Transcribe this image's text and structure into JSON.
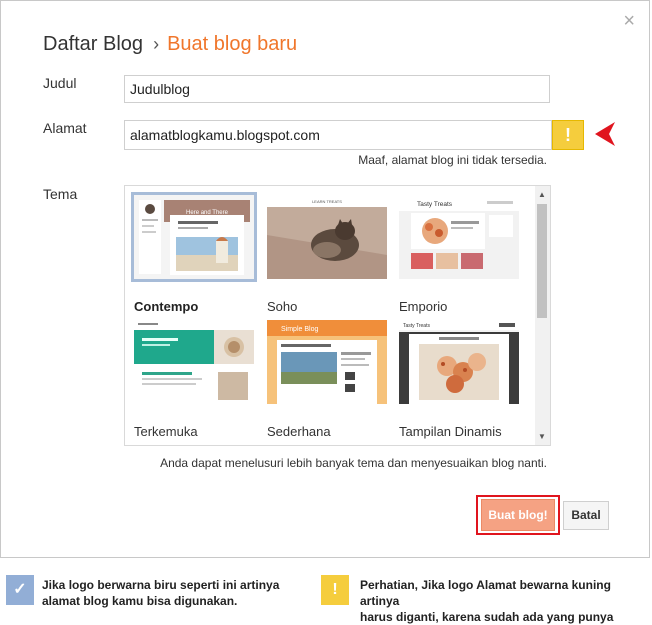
{
  "dialog": {
    "close_glyph": "×",
    "breadcrumb_root": "Daftar Blog",
    "breadcrumb_sep": "›",
    "breadcrumb_current": "Buat blog baru"
  },
  "form": {
    "title_label": "Judul",
    "title_value": "Judulblog",
    "address_label": "Alamat",
    "address_value": "alamatblogkamu.blogspot.com",
    "address_warning_glyph": "!",
    "address_error": "Maaf, alamat blog ini tidak tersedia.",
    "theme_label": "Tema",
    "themes": [
      {
        "name": "Contempo",
        "selected": true
      },
      {
        "name": "Soho",
        "selected": false
      },
      {
        "name": "Emporio",
        "selected": false
      },
      {
        "name": "Terkemuka",
        "selected": false
      },
      {
        "name": "Sederhana",
        "selected": false
      },
      {
        "name": "Tampilan Dinamis",
        "selected": false
      }
    ],
    "theme_hint": "Anda dapat menelusuri lebih banyak tema dan menyesuaikan blog nanti."
  },
  "thumb_text": {
    "contempo_banner": "Here and There",
    "soho_brand": "LEARN TREATS",
    "emporio_brand": "Tasty Treats",
    "sederhana_brand": "Simple Blog",
    "dynamic_brand": "Tasty Treats"
  },
  "actions": {
    "create_label": "Buat blog!",
    "cancel_label": "Batal"
  },
  "legend": {
    "blue_glyph": "✓",
    "blue_line1": "Jika logo berwarna biru seperti ini artinya",
    "blue_line2": "alamat blog kamu bisa digunakan.",
    "yellow_glyph": "!",
    "yellow_line1": "Perhatian, Jika logo Alamat bewarna kuning artinya",
    "yellow_line2": "harus diganti, karena sudah ada yang punya"
  },
  "colors": {
    "accent": "#f0762b",
    "warning": "#f5cd3d",
    "confirm_blue": "#92aed6",
    "highlight_red": "#e0141e"
  }
}
